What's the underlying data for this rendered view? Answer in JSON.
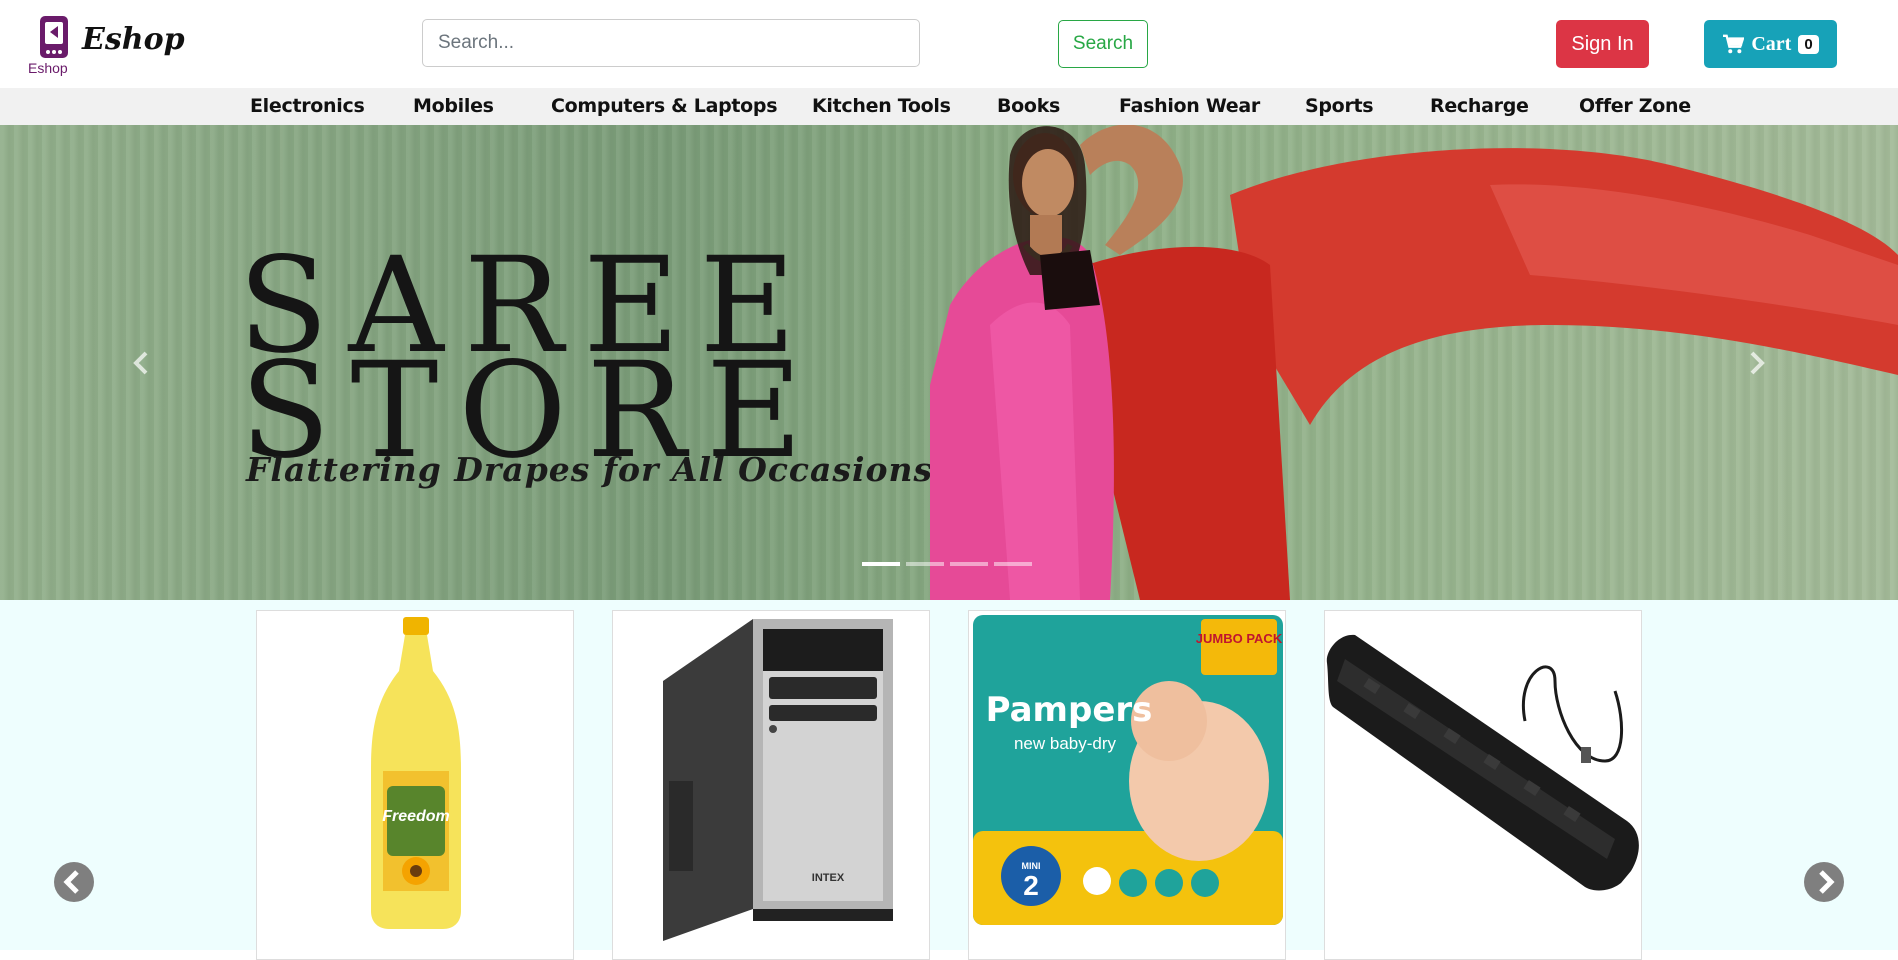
{
  "header": {
    "logo_text": "Eshop",
    "logo_subtext": "Eshop",
    "search_placeholder": "Search...",
    "search_button": "Search",
    "signin_button": "Sign In",
    "cart_label": "Cart",
    "cart_count": "0"
  },
  "nav": {
    "items": [
      "Electronics",
      "Mobiles",
      "Computers & Laptops",
      "Kitchen Tools",
      "Books",
      "Fashion Wear",
      "Sports",
      "Recharge",
      "Offer Zone"
    ]
  },
  "hero": {
    "title_line1": "SAREE",
    "title_line2": "STORE",
    "tagline": "Flattering Drapes for All Occasions",
    "active_slide": 1,
    "slide_count": 4
  },
  "products": [
    {
      "image": "cooking-oil-bottle",
      "brand_text": "Freedom"
    },
    {
      "image": "desktop-cpu-cabinet",
      "brand_text": "INTEX"
    },
    {
      "image": "diaper-pack",
      "brand_text": "Pampers",
      "sub_text": "new baby-dry",
      "badge": "JUMBO PACK",
      "size": "2",
      "size_label": "MINI"
    },
    {
      "image": "keyboard",
      "brand_text": ""
    }
  ],
  "colors": {
    "signin": "#dc3545",
    "cart": "#17a2b8",
    "search_outline": "#28a745",
    "nav_bg": "#f1f1f1",
    "products_bg": "#eefefe"
  }
}
